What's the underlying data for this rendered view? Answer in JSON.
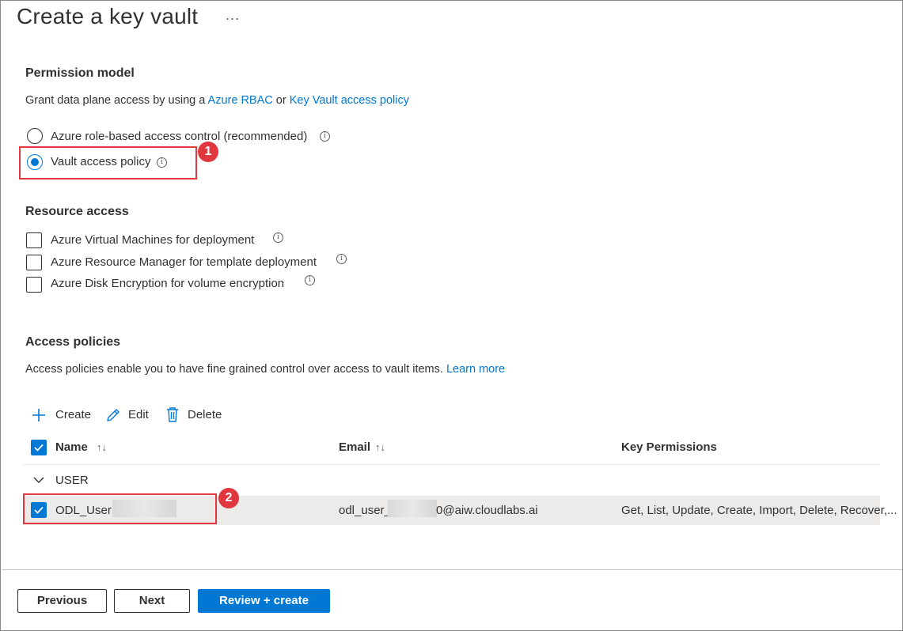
{
  "page": {
    "title": "Create a key vault",
    "more_label": "..."
  },
  "permission_model": {
    "heading": "Permission model",
    "desc_prefix": "Grant data plane access by using a ",
    "link_rbac": "Azure RBAC",
    "desc_or": " or ",
    "link_policy": "Key Vault access policy",
    "options": [
      {
        "label": "Azure role-based access control (recommended)",
        "selected": false
      },
      {
        "label": "Vault access policy",
        "selected": true
      }
    ]
  },
  "resource_access": {
    "heading": "Resource access",
    "options": [
      {
        "label": "Azure Virtual Machines for deployment",
        "checked": false
      },
      {
        "label": "Azure Resource Manager for template deployment",
        "checked": false
      },
      {
        "label": "Azure Disk Encryption for volume encryption",
        "checked": false
      }
    ]
  },
  "access_policies": {
    "heading": "Access policies",
    "desc": "Access policies enable you to have fine grained control over access to vault items. ",
    "learn_more": "Learn more",
    "toolbar": {
      "create": "Create",
      "edit": "Edit",
      "delete": "Delete"
    },
    "columns": {
      "name": "Name",
      "email": "Email",
      "key_permissions": "Key Permissions"
    },
    "sort_glyph": "↑↓",
    "group_label": "USER",
    "rows": [
      {
        "name": "ODL_User",
        "email_prefix": "odl_user_",
        "email_suffix": "0@aiw.cloudlabs.ai",
        "key_permissions": "Get, List, Update, Create, Import, Delete, Recover,...",
        "checked": true
      }
    ]
  },
  "callouts": [
    "1",
    "2"
  ],
  "footer": {
    "previous": "Previous",
    "next": "Next",
    "review_create": "Review + create"
  },
  "colors": {
    "accent": "#0078d4",
    "callout": "#e0383e",
    "selected_row": "#edebe9"
  }
}
